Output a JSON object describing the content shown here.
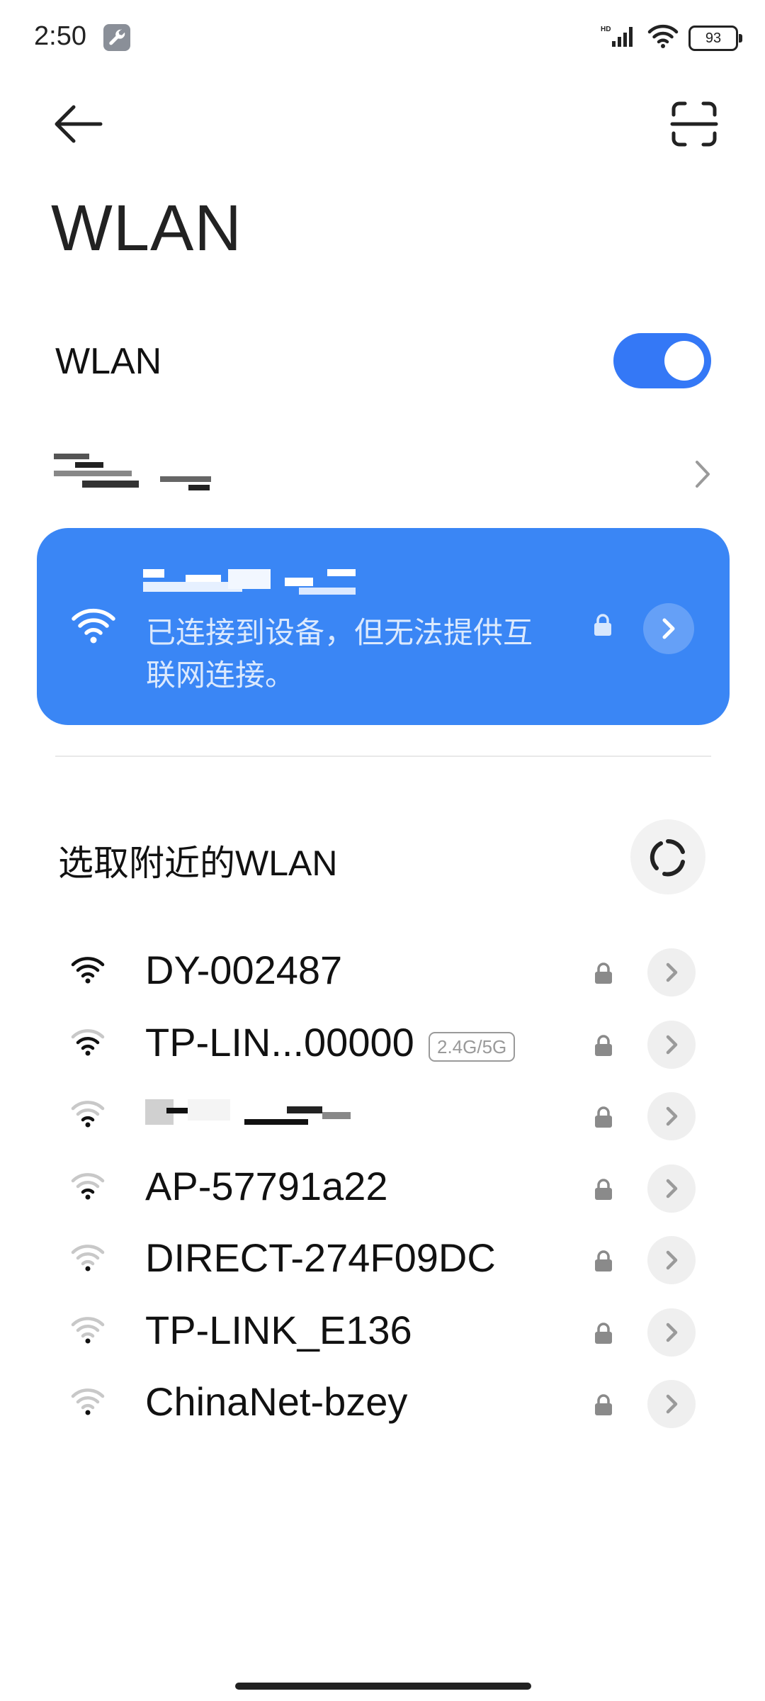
{
  "status_bar": {
    "time": "2:50",
    "network_type": "HD",
    "battery_level": "93"
  },
  "header": {
    "title": "WLAN",
    "back_icon": "arrow-left-icon",
    "scan_icon": "qr-scan-icon"
  },
  "wlan_toggle": {
    "label": "WLAN",
    "enabled": true,
    "accent_color": "#3478f6"
  },
  "saved_networks": {
    "label_redacted": true
  },
  "connected_network": {
    "name_redacted": true,
    "status": "已连接到设备，但无法提供互联网连接。",
    "secured": true,
    "card_color": "#3a86f5"
  },
  "nearby": {
    "label": "选取附近的WLAN",
    "refresh_icon": "refresh-icon",
    "networks": [
      {
        "name": "DY-002487",
        "signal": 4,
        "secured": true,
        "badge": ""
      },
      {
        "name": "TP-LIN...00000",
        "signal": 3,
        "secured": true,
        "badge": "2.4G/5G"
      },
      {
        "name": "",
        "signal": 2,
        "secured": true,
        "badge": "",
        "redacted": true
      },
      {
        "name": "AP-57791a22",
        "signal": 2,
        "secured": true,
        "badge": ""
      },
      {
        "name": "DIRECT-274F09DC",
        "signal": 1,
        "secured": true,
        "badge": ""
      },
      {
        "name": "TP-LINK_E136",
        "signal": 1,
        "secured": true,
        "badge": ""
      },
      {
        "name": "ChinaNet-bzey",
        "signal": 1,
        "secured": true,
        "badge": ""
      }
    ]
  }
}
